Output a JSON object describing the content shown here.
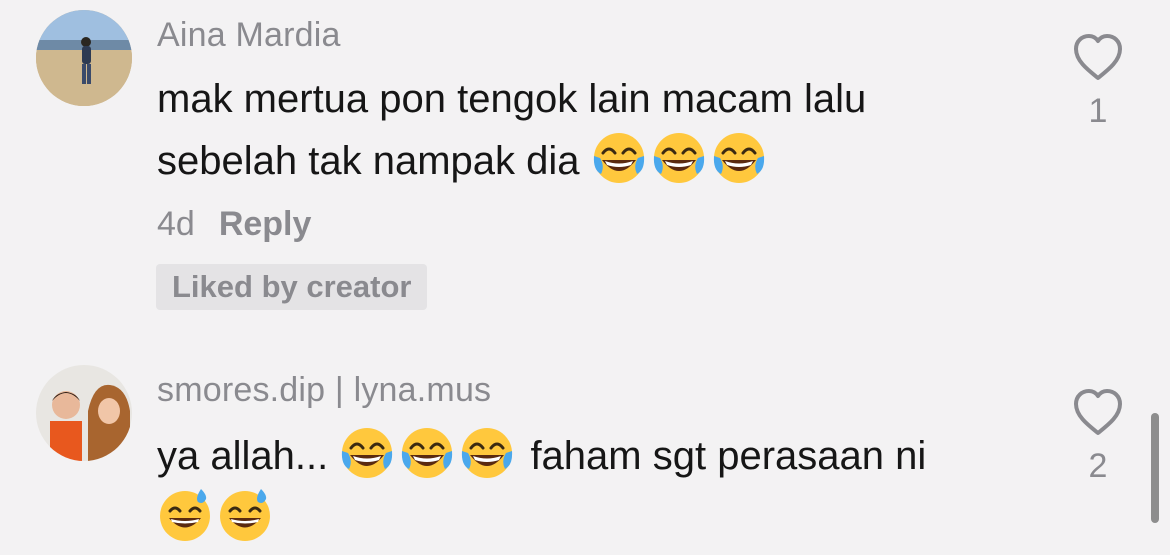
{
  "comments": [
    {
      "username": "Aina Mardia",
      "text_lines": [
        "mak mertua pon tengok lain macam lalu",
        "sebelah tak nampak dia "
      ],
      "time": "4d",
      "reply_label": "Reply",
      "liked_label": "Liked by creator",
      "likes": "1",
      "emojis": [
        "joy-emoji",
        "joy-emoji",
        "joy-emoji"
      ]
    },
    {
      "username": "smores.dip | lyna.mus",
      "text_before": "ya allah... ",
      "text_after": " faham sgt perasaan ni",
      "likes": "2",
      "emojis_inline": [
        "joy-emoji",
        "joy-emoji",
        "joy-emoji"
      ],
      "emojis_line2": [
        "sweat-smile-emoji",
        "sweat-smile-emoji"
      ]
    }
  ],
  "colors": {
    "background": "#f3f2f3",
    "text": "#161616",
    "secondary": "#8a8a8f",
    "badge_bg": "#e4e3e5"
  },
  "icons": [
    "heart-icon"
  ]
}
